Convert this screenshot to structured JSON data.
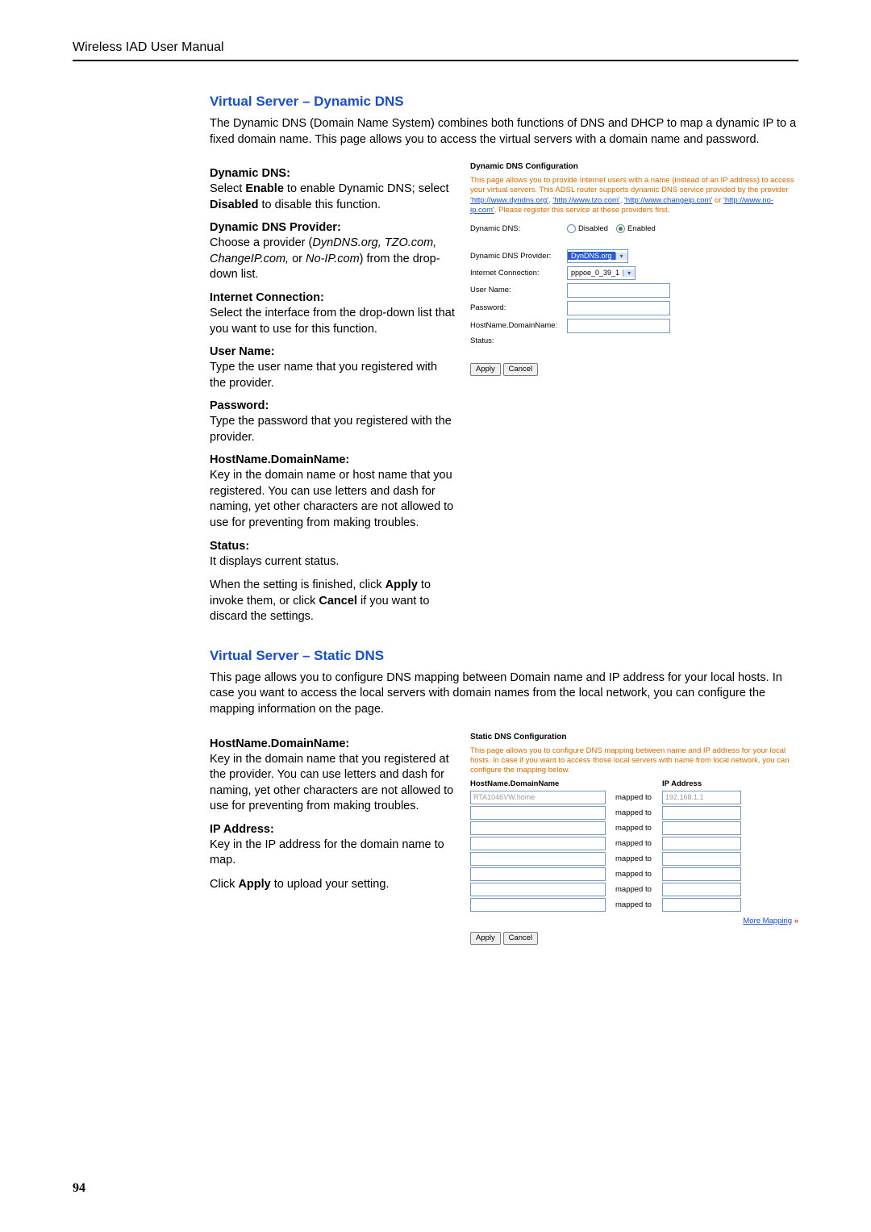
{
  "header": "Wireless IAD User Manual",
  "page_number": "94",
  "section1": {
    "title": "Virtual Server – Dynamic DNS",
    "intro": "The Dynamic DNS (Domain Name System) combines both functions of DNS and DHCP to map a dynamic IP to a fixed domain name. This page allows you to access the virtual servers with a domain name and password.",
    "fields": {
      "dyndns_label": "Dynamic DNS:",
      "dyndns_desc_pre": "Select ",
      "dyndns_desc_enable": "Enable",
      "dyndns_desc_mid": " to enable Dynamic DNS; select ",
      "dyndns_desc_disabled": "Disabled",
      "dyndns_desc_post": " to disable this function.",
      "provider_label": "Dynamic DNS Provider:",
      "provider_desc_pre": "Choose a provider (",
      "provider_desc_italic": "DynDNS.org, TZO.com, ChangeIP.com,",
      "provider_desc_or": " or ",
      "provider_desc_italic2": "No-IP.com",
      "provider_desc_post": ") from the drop-down list.",
      "internet_label": "Internet Connection:",
      "internet_desc": "Select the interface from the drop-down list that you want to use for this function.",
      "user_label": "User Name:",
      "user_desc": "Type the user name that you registered with the provider.",
      "pass_label": "Password:",
      "pass_desc": "Type the password that you registered with the provider.",
      "host_label": "HostName.DomainName:",
      "host_desc": "Key in the domain name or host name that you registered. You can use letters and dash for naming, yet other characters are not allowed to use for preventing from making troubles.",
      "status_label": "Status:",
      "status_desc": "It displays current status.",
      "closing_pre": "When the setting is finished, click ",
      "closing_apply": "Apply",
      "closing_mid": " to invoke them, or click ",
      "closing_cancel": "Cancel",
      "closing_post": " if you want to discard the settings."
    },
    "panel": {
      "title": "Dynamic DNS Configuration",
      "desc1": "This page allows you to provide Internet users with a name (instead of an IP address) to access your virtual servers. This ADSL router supports dynamic DNS service provided by the provider ",
      "link1": "'http://www.dyndns.org'",
      "comma1": ", ",
      "link2": "'http://www.tzo.com'",
      "comma2": ", ",
      "link3": "'http://www.changeip.com'",
      "or": " or ",
      "link4": "'http://www.no-ip.com'",
      "desc2": ". Please register this service at these providers first.",
      "row_dyndns": "Dynamic DNS:",
      "radio_disabled": "Disabled",
      "radio_enabled": "Enabled",
      "row_provider": "Dynamic DNS Provider:",
      "provider_value": "DynDNS.org",
      "row_internet": "Internet Connection:",
      "internet_value": "pppoe_0_39_1",
      "row_user": "User Name:",
      "row_pass": "Password:",
      "row_host": "HostName.DomainName:",
      "row_status": "Status:",
      "apply": "Apply",
      "cancel": "Cancel"
    }
  },
  "section2": {
    "title": "Virtual Server – Static DNS",
    "intro": "This page allows you to configure DNS mapping between Domain name and IP address for your local hosts. In case you want to access the local servers with domain names from the local network, you can configure the mapping information on the page.",
    "fields": {
      "host_label": "HostName.DomainName:",
      "host_desc": "Key in the domain name that you registered at the provider. You can use letters and dash for naming, yet other characters are not allowed to use for preventing from making troubles.",
      "ip_label": "IP Address:",
      "ip_desc": "Key in the IP address for the domain name to map.",
      "closing_pre": "Click ",
      "closing_apply": "Apply",
      "closing_post": " to upload your setting."
    },
    "panel": {
      "title": "Static DNS Configuration",
      "desc": "This page allows you to configure DNS mapping between name and IP address for your local hosts. In case if you want to access those local servers with name from local network, you can configure the mapping below.",
      "col_host": "HostName.DomainName",
      "col_ip": "IP Address",
      "mapped_to": "mapped to",
      "row0_host": "RTA1046VW.home",
      "row0_ip": "192.168.1.1",
      "more_mapping": "More Mapping",
      "apply": "Apply",
      "cancel": "Cancel"
    }
  }
}
